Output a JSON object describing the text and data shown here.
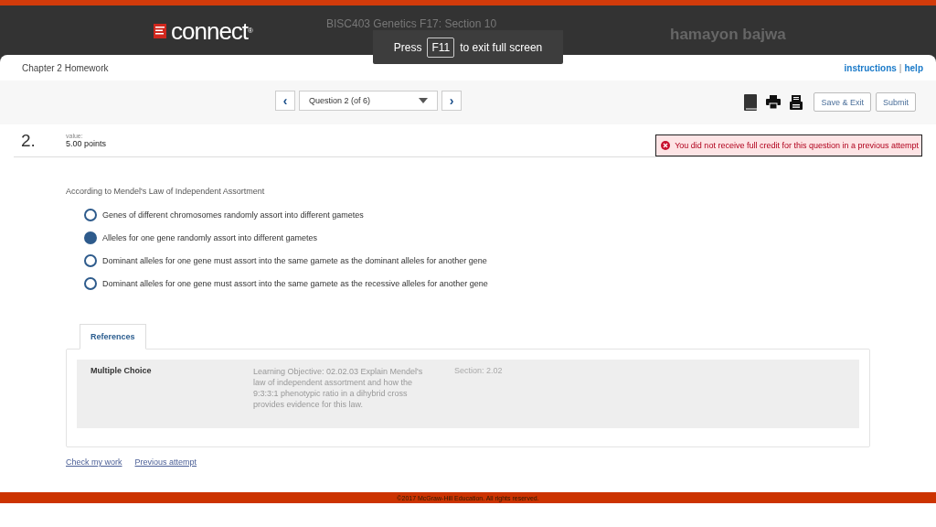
{
  "header": {
    "brand": "connect",
    "brand_mark": "®",
    "course": "BISC403 Genetics F17: Section 10",
    "user": "hamayon bajwa"
  },
  "fullscreen_toast": {
    "before": "Press",
    "key": "F11",
    "after": "to exit full screen"
  },
  "assignment": {
    "title": "Chapter 2 Homework",
    "links": [
      "instructions",
      "help"
    ],
    "separator": "|"
  },
  "nav": {
    "prev": "‹",
    "question": "Question 2 (of 6)",
    "next": "›",
    "buttons": [
      "Save & Exit",
      "Submit"
    ]
  },
  "question": {
    "number": "2.",
    "value_label": "value:",
    "points": "5.00 points",
    "alert": "You did not receive full credit for this question in a previous attempt",
    "prompt": "According to Mendel's Law of Independent Assortment",
    "options": [
      {
        "label": "Genes of different chromosomes randomly assort into different gametes",
        "selected": false
      },
      {
        "label": "Alleles for one gene randomly assort into different gametes",
        "selected": true
      },
      {
        "label": "Dominant alleles for one gene must assort into the same gamete as the dominant alleles for another gene",
        "selected": false
      },
      {
        "label": "Dominant alleles for one gene must assort into the same gamete as the recessive alleles for another gene",
        "selected": false
      }
    ]
  },
  "references": {
    "tab": "References",
    "type": "Multiple Choice",
    "objective": "Learning Objective: 02.02.03 Explain Mendel's law of independent assortment and how the 9:3:3:1 phenotypic ratio in a dihybrid cross provides evidence for this law.",
    "section": "Section: 2.02"
  },
  "actions": [
    "Check my work",
    "Previous attempt"
  ],
  "footer": "©2017 McGraw-Hill Education. All rights reserved."
}
